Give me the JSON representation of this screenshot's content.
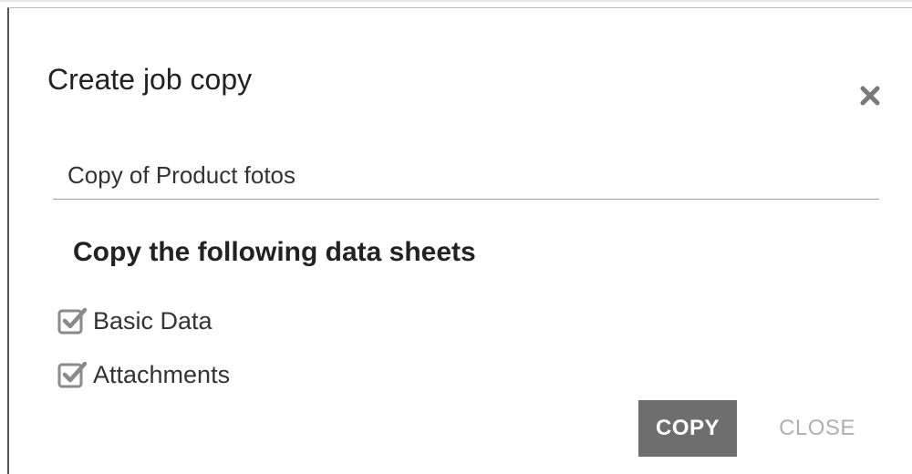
{
  "dialog": {
    "title": "Create job copy",
    "close_icon": "close-icon"
  },
  "name_input": {
    "value": "Copy of Product fotos"
  },
  "section": {
    "heading": "Copy the following data sheets"
  },
  "options": [
    {
      "label": "Basic Data",
      "checked": true,
      "icon": "checkbox-checked-icon"
    },
    {
      "label": "Attachments",
      "checked": true,
      "icon": "checkbox-checked-icon"
    }
  ],
  "actions": {
    "copy_label": "COPY",
    "close_label": "CLOSE"
  },
  "colors": {
    "primary_button": "#6e6e6e",
    "disabled_text": "#b0b0b0",
    "checkbox": "#8a8a8a"
  }
}
